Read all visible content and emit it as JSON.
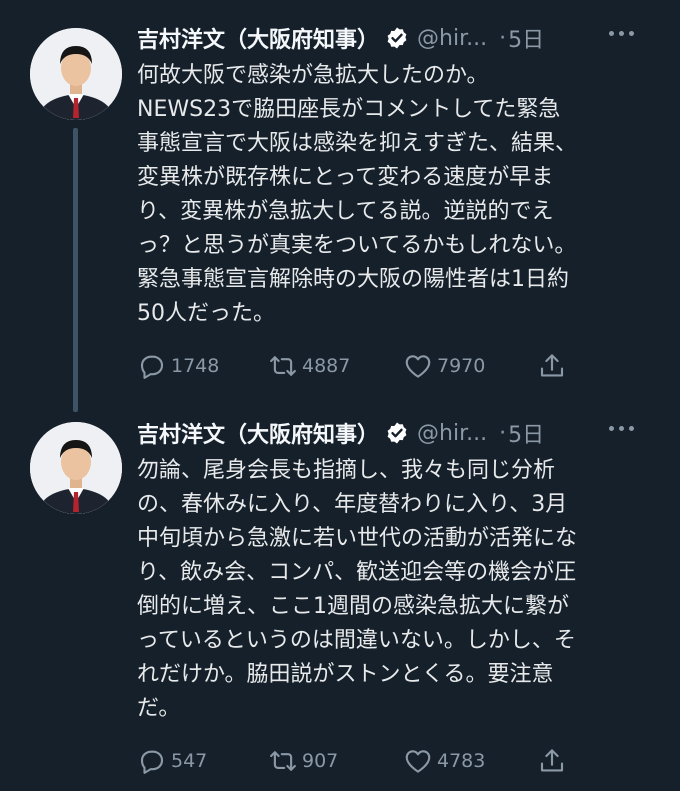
{
  "tweets": [
    {
      "author_name": "吉村洋文（大阪府知事）",
      "handle": "@hir...",
      "dot": "·",
      "time": "5日",
      "lines": [
        "何故大阪で感染が急拡大したのか。",
        "NEWS23で脇田座長がコメントしてた緊急",
        "事態宣言で大阪は感染を抑えすぎた、結果、",
        "変異株が既存株にとって変わる速度が早ま",
        "り、変異株が急拡大してる説。逆説的でえ",
        "っ？と思うが真実をついてるかもしれない。",
        "緊急事態宣言解除時の大阪の陽性者は1日約",
        "50人だった。"
      ],
      "replies": "1748",
      "retweets": "4887",
      "likes": "7970"
    },
    {
      "author_name": "吉村洋文（大阪府知事）",
      "handle": "@hir...",
      "dot": "·",
      "time": "5日",
      "lines": [
        "勿論、尾身会長も指摘し、我々も同じ分析",
        "の、春休みに入り、年度替わりに入り、3月",
        "中旬頃から急激に若い世代の活動が活発にな",
        "り、飲み会、コンパ、歓送迎会等の機会が圧",
        "倒的に増え、ここ1週間の感染急拡大に繋が",
        "っているというのは間違いない。しかし、そ",
        "れだけか。脇田説がストンとくる。要注意",
        "だ。"
      ],
      "replies": "547",
      "retweets": "907",
      "likes": "4783"
    }
  ],
  "icons": {
    "verified": "verified-badge-icon",
    "more": "more-options-icon",
    "reply": "reply-icon",
    "retweet": "retweet-icon",
    "like": "heart-icon",
    "share": "share-icon"
  },
  "colors": {
    "background": "#15202b",
    "text": "#e7e9ea",
    "muted": "#8b98a5",
    "thread_line": "#3d5466"
  }
}
